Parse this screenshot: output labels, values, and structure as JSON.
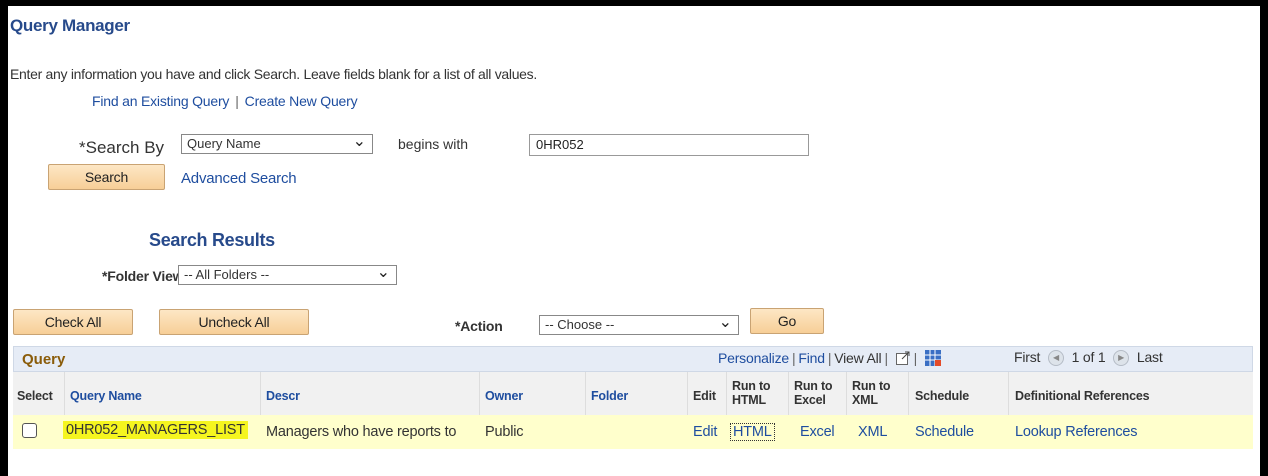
{
  "page": {
    "title": "Query Manager",
    "instructions": "Enter any information you have and click Search. Leave fields blank for a list of all values."
  },
  "nav": {
    "find_existing": "Find an Existing Query",
    "separator": "|",
    "create_new": "Create New Query"
  },
  "search": {
    "search_by_label": "*Search By",
    "search_by_value": "Query Name",
    "operator": "begins with",
    "value": "0HR052",
    "search_button": "Search",
    "advanced_search": "Advanced Search"
  },
  "results": {
    "title": "Search Results",
    "folder_view_label": "*Folder View",
    "folder_view_value": "-- All Folders --",
    "check_all": "Check All",
    "uncheck_all": "Uncheck All",
    "action_label": "*Action",
    "action_value": "-- Choose --",
    "go_button": "Go"
  },
  "grid": {
    "title": "Query",
    "personalize": "Personalize",
    "find": "Find",
    "view_all": "View All",
    "sep": "|",
    "first": "First",
    "page_info": "1 of 1",
    "last": "Last",
    "columns": {
      "select": "Select",
      "query_name": "Query Name",
      "descr": "Descr",
      "owner": "Owner",
      "folder": "Folder",
      "edit": "Edit",
      "run_html_1": "Run to",
      "run_html_2": "HTML",
      "run_excel_1": "Run to",
      "run_excel_2": "Excel",
      "run_xml_1": "Run to",
      "run_xml_2": "XML",
      "schedule": "Schedule",
      "def_refs": "Definitional References"
    },
    "rows": [
      {
        "query_name": "0HR052_MANAGERS_LIST",
        "descr": "Managers who have reports to",
        "owner": "Public",
        "folder": "",
        "edit": "Edit",
        "run_html": "HTML",
        "run_excel": "Excel",
        "run_xml": "XML",
        "schedule": "Schedule",
        "def_refs": "Lookup References"
      }
    ]
  },
  "icons": {
    "zoom": "new-window-icon",
    "download": "download-grid-icon",
    "prev": "previous-arrow-icon",
    "next": "next-arrow-icon",
    "dropdown": "chevron-down-icon"
  },
  "colors": {
    "title_blue": "#274a8b",
    "link_blue": "#1e4d9f",
    "button_orange": "#f7cf97",
    "row_highlight": "#ffffcc",
    "name_highlight": "#f5f51f"
  }
}
